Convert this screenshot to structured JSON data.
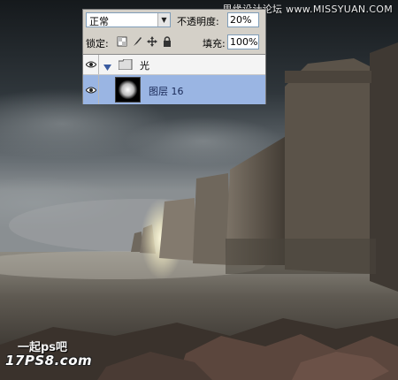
{
  "watermark": "思缘设计论坛  www.MISSYUAN.COM",
  "site_logo": {
    "line1": "一起ps吧",
    "line2": "17PS8.com"
  },
  "layers_panel": {
    "blend_mode": "正常",
    "opacity_label": "不透明度:",
    "opacity_value": "20%",
    "lock_label": "锁定:",
    "lock_icons": [
      "lock-transparent-icon",
      "lock-paint-icon",
      "lock-move-icon",
      "lock-all-icon"
    ],
    "fill_label": "填充:",
    "fill_value": "100%",
    "group": {
      "name": "光",
      "expanded": true
    },
    "layer": {
      "name": "图层 16",
      "selected": true
    }
  },
  "colors": {
    "panel_bg": "#d4d0c8",
    "selected_row": "#9ab5e3",
    "sky_dark": "#1f2428",
    "glow": "#fffbe0"
  }
}
